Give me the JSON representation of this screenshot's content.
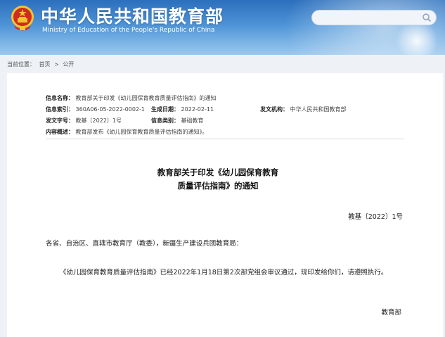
{
  "header": {
    "title_cn": "中华人民共和国教育部",
    "title_en": "Ministry of Education of the People's Republic of China",
    "search_placeholder": ""
  },
  "breadcrumb": {
    "prefix": "当前位置：",
    "items": [
      "首页",
      "公开"
    ],
    "separator": ">"
  },
  "meta": {
    "info_name_label": "信息名称：",
    "info_name_value": "教育部关于印发《幼儿园保育教育质量评估指南》的通知",
    "index_label": "信息索引：",
    "index_value": "360A06-05-2022-0002-1",
    "date_label": "生成日期：",
    "date_value": "2022-02-11",
    "issuer_label": "发文机构：",
    "issuer_value": "中华人民共和国教育部",
    "doc_no_label": "发文字号：",
    "doc_no_value": "教基〔2022〕1号",
    "category_label": "信息类别：",
    "category_value": "基础教育",
    "summary_label": "内容概述：",
    "summary_value": "教育部发布《幼儿园保育教育质量评估指南的通知》。"
  },
  "document": {
    "title_line1": "教育部关于印发《幼儿园保育教育",
    "title_line2": "质量评估指南》的通知",
    "number": "教基〔2022〕1号",
    "salutation": "各省、自治区、直辖市教育厅（教委），新疆生产建设兵团教育局：",
    "body": "《幼儿园保育教育质量评估指南》已经2022年1月18日第2次部党组会审议通过，现印发给你们，请遵照执行。",
    "signature": "教育部"
  },
  "colors": {
    "header_blue": "#2c6fbd",
    "emblem_red": "#d12a1e",
    "emblem_gold": "#f3c430"
  }
}
